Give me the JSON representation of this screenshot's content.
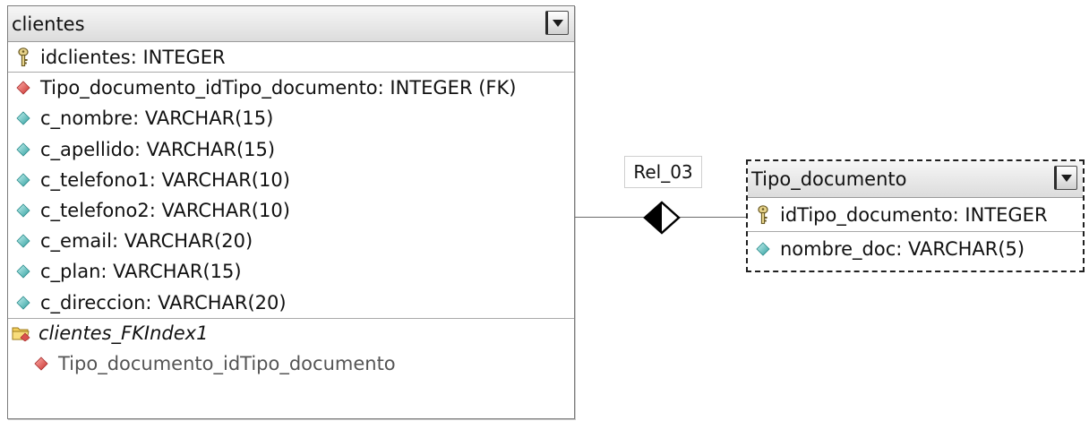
{
  "tables": {
    "clientes": {
      "title": "clientes",
      "primary_key": "idclientes: INTEGER",
      "columns": [
        {
          "label": "Tipo_documento_idTipo_documento: INTEGER (FK)",
          "kind": "foreign-key"
        },
        {
          "label": "c_nombre: VARCHAR(15)",
          "kind": "attribute"
        },
        {
          "label": "c_apellido: VARCHAR(15)",
          "kind": "attribute"
        },
        {
          "label": "c_telefono1: VARCHAR(10)",
          "kind": "attribute"
        },
        {
          "label": "c_telefono2: VARCHAR(10)",
          "kind": "attribute"
        },
        {
          "label": "c_email: VARCHAR(20)",
          "kind": "attribute"
        },
        {
          "label": "c_plan: VARCHAR(15)",
          "kind": "attribute"
        },
        {
          "label": "c_direccion: VARCHAR(20)",
          "kind": "attribute"
        }
      ],
      "index": {
        "name": "clientes_FKIndex1",
        "column": "Tipo_documento_idTipo_documento"
      }
    },
    "tipo_documento": {
      "title": "Tipo_documento",
      "primary_key": "idTipo_documento: INTEGER",
      "columns": [
        {
          "label": "nombre_doc: VARCHAR(5)",
          "kind": "attribute"
        }
      ]
    }
  },
  "relationship": {
    "label": "Rel_03"
  },
  "icons": {
    "primary_key": "key-icon",
    "foreign_key": "red-diamond-icon",
    "attribute": "teal-diamond-icon",
    "index": "folder-index-icon",
    "menu": "dropdown-arrow-icon"
  },
  "colors": {
    "foreign_key": "#d9534f",
    "attribute": "#3fb4b4",
    "border_selected": "#202020",
    "line": "#6b6b6b"
  }
}
